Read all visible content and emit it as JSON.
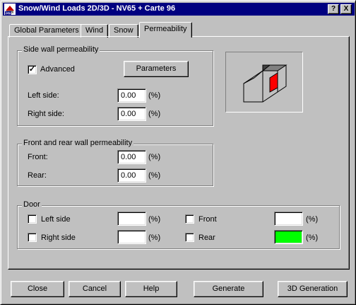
{
  "window": {
    "title": "Snow/Wind Loads 2D/3D - NV65 + Carte 96",
    "help_glyph": "?",
    "close_glyph": "X",
    "icon": "robot-pro-app-icon"
  },
  "tabs": [
    {
      "label": "Global Parameters",
      "active": false
    },
    {
      "label": "Wind",
      "active": false
    },
    {
      "label": "Snow",
      "active": false
    },
    {
      "label": "Permeability",
      "active": true
    }
  ],
  "side_wall": {
    "title": "Side wall permeability",
    "advanced_label": "Advanced",
    "advanced_checked": true,
    "parameters_button": "Parameters",
    "left_label": "Left side:",
    "left_value": "0.00",
    "right_label": "Right side:",
    "right_value": "0.00",
    "unit": "(%)"
  },
  "front_rear": {
    "title": "Front and rear wall permeability",
    "front_label": "Front:",
    "front_value": "0.00",
    "rear_label": "Rear:",
    "rear_value": "0.00",
    "unit": "(%)"
  },
  "door": {
    "title": "Door",
    "left_label": "Left side",
    "left_value": "",
    "right_label": "Right side",
    "right_value": "",
    "front_label": "Front",
    "front_value": "",
    "rear_label": "Rear",
    "rear_value": "",
    "unit": "(%)",
    "rear_color": "#00ff00"
  },
  "buttons": {
    "close": "Close",
    "cancel": "Cancel",
    "help": "Help",
    "generate": "Generate",
    "generation_3d": "3D Generation"
  },
  "preview": {
    "icon": "building-permeability-preview",
    "highlight_color": "#ff0000"
  }
}
